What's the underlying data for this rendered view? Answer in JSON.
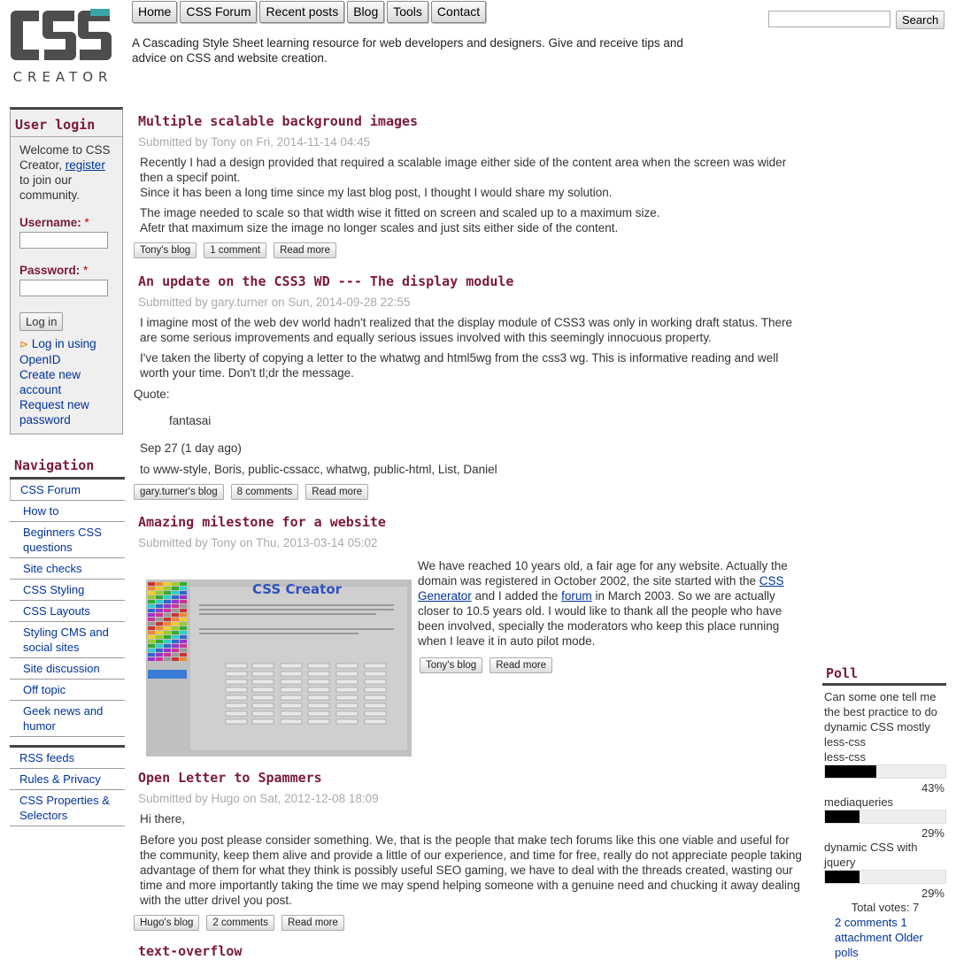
{
  "site": {
    "logo_text": "CREATOR",
    "logo_letters": "CSS",
    "tagline": "A Cascading Style Sheet learning resource for web developers and designers. Give and receive tips and advice on CSS and website creation."
  },
  "nav": [
    "Home",
    "CSS Forum",
    "Recent posts",
    "Blog",
    "Tools",
    "Contact"
  ],
  "search": {
    "button": "Search"
  },
  "login": {
    "title": "User login",
    "welcome_pre": "Welcome to CSS Creator,",
    "register": "register",
    "welcome_post": "to join our community.",
    "username_label": "Username:",
    "password_label": "Password:",
    "required": "*",
    "login_button": "Log in",
    "openid": "Log in using OpenID",
    "create": "Create new account",
    "reset": "Request new password"
  },
  "navigation": {
    "title": "Navigation",
    "items": [
      "CSS Forum",
      "How to",
      "Beginners CSS questions",
      "Site checks",
      "CSS Styling",
      "CSS Layouts",
      "Styling CMS and social sites",
      "Site discussion",
      "Off topic",
      "Geek news and humor"
    ]
  },
  "extra_links": [
    "RSS feeds",
    "Rules & Privacy",
    "CSS Properties & Selectors"
  ],
  "posts": [
    {
      "title": "Multiple scalable background images",
      "submitted": "Submitted by Tony on Fri, 2014-11-14 04:45",
      "p1": "Recently I had a design provided that required a scalable image either side of the content area when the screen was wider then a specif point.",
      "p2": "Since it has been a long time since my last blog post, I thought I would share my solution.",
      "p3": "The image needed to scale so that width wise it fitted on screen and scaled up to a maximum size.",
      "p4": "Afetr that maximum size the image no longer scales and just sits either side of the content.",
      "links": [
        "Tony's blog",
        "1 comment",
        "Read more"
      ]
    },
    {
      "title": "An update on the CSS3 WD --- The display module",
      "submitted": "Submitted by gary.turner on Sun, 2014-09-28 22:55",
      "p1": "I imagine most of the web dev world hadn't realized that the display module of CSS3 was only in working draft status. There are some serious improvements and equally serious issues involved with this seemingly innocuous property.",
      "p2": "I've taken the liberty of copying a letter to the whatwg and html5wg from the css3 wg. This is informative reading and well worth your time. Don't tl;dr the message.",
      "quote_label": "Quote:",
      "quote": "fantasai",
      "date": "Sep 27 (1 day ago)",
      "to": "to www-style, Boris, public-cssacc, whatwg, public-html, List, Daniel",
      "links": [
        "gary.turner's blog",
        "8 comments",
        "Read more"
      ]
    },
    {
      "title": "Amazing milestone for a website",
      "submitted": "Submitted by Tony on Thu, 2013-03-14 05:02",
      "p1a": "We have reached 10 years old, a fair age for any website. Actually the domain was registered in October 2002, the site started with the",
      "link1": "CSS Generator",
      "p1b": "and I added the",
      "link2": "forum",
      "p1c": "in March 2003. So we are actually closer to 10.5 years old. I would like to thank all the people who have been involved, specially the moderators who keep this place running when I leave it in auto pilot mode.",
      "image_title": "CSS Creator",
      "links": [
        "Tony's blog",
        "Read more"
      ]
    },
    {
      "title": "Open Letter to Spammers",
      "submitted": "Submitted by Hugo on Sat, 2012-12-08 18:09",
      "p1": "Hi there,",
      "p2": "Before you post please consider something. We, that is the people that make tech forums like this one viable and useful for the community, keep them alive and provide a little of our experience, and time for free, really do not appreciate people taking advantage of them for what they think is possibly useful SEO gaming, we have to deal with the threads created, wasting our time and more importantly taking the time we may spend helping someone with a genuine need and chucking it away dealing with the utter drivel you post.",
      "links": [
        "Hugo's blog",
        "2 comments",
        "Read more"
      ]
    },
    {
      "title": "text-overflow"
    }
  ],
  "poll": {
    "title": "Poll",
    "question": "Can some one tell me the best practice to do dynamic CSS mostly less-css",
    "choices": [
      {
        "label": "less-css",
        "pct": "43%",
        "value": 0.43
      },
      {
        "label": "mediaqueries",
        "pct": "29%",
        "value": 0.29
      },
      {
        "label": "dynamic CSS with jquery",
        "pct": "29%",
        "value": 0.29
      }
    ],
    "total": "Total votes: 7",
    "comments": "2 comments",
    "attachment": "1 attachment",
    "older": "Older polls"
  }
}
